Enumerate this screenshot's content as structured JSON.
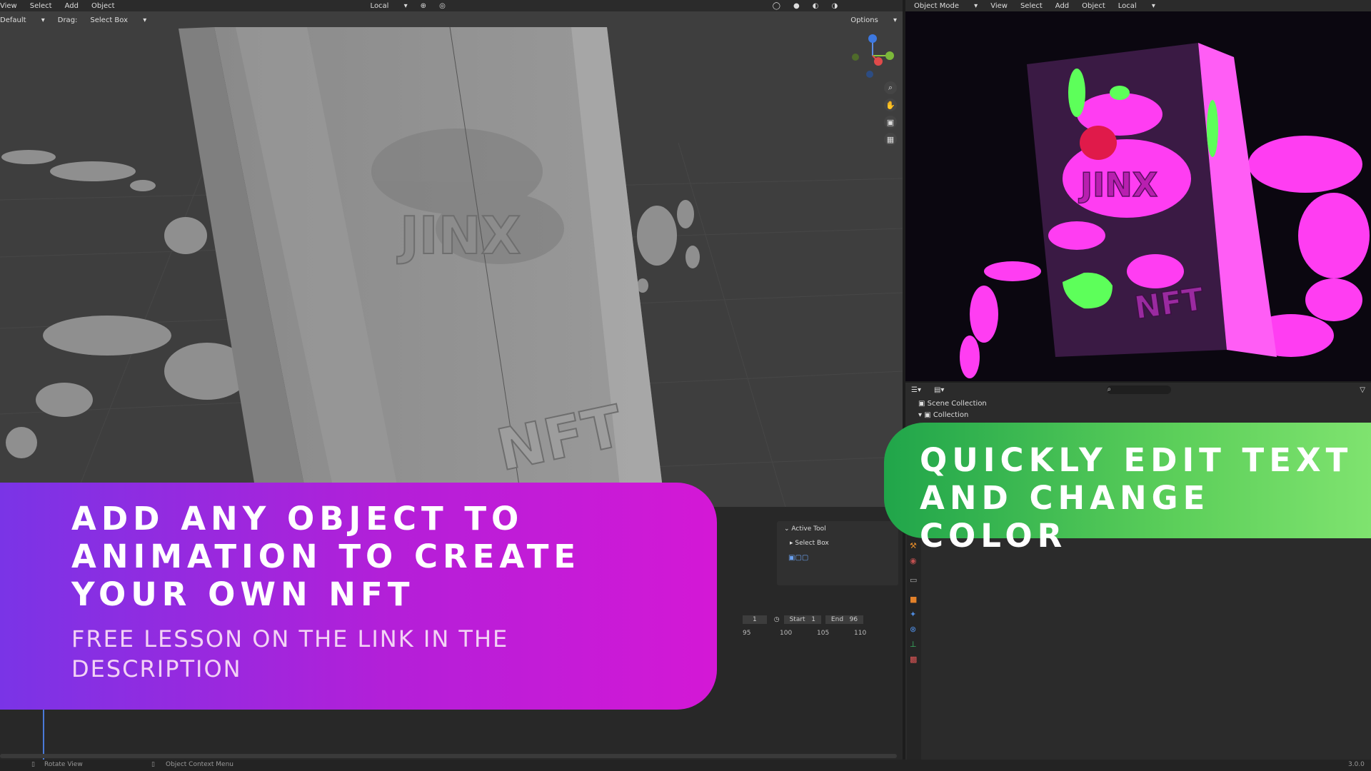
{
  "left_viewport": {
    "menu": [
      "View",
      "Select",
      "Add",
      "Object"
    ],
    "orientation": "Local",
    "mode_select": "Default",
    "drag_label": "Drag:",
    "drag_value": "Select Box",
    "options_label": "Options",
    "model_text_1": "JINX",
    "model_text_2": "NFT"
  },
  "right_viewport": {
    "mode": "Object Mode",
    "menu": [
      "View",
      "Select",
      "Add",
      "Object"
    ],
    "orientation": "Local",
    "model_text_1": "JINX",
    "model_text_2": "NFT"
  },
  "outliner": {
    "scene_collection": "Scene Collection",
    "collection": "Collection"
  },
  "active_tool": {
    "header": "Active Tool",
    "tool_name": "Select Box"
  },
  "timeline": {
    "current_frame": "1",
    "start_label": "Start",
    "start_value": "1",
    "end_label": "End",
    "end_value": "96",
    "ticks": [
      "95",
      "100",
      "105",
      "110"
    ]
  },
  "status_bar": {
    "left_action": "Rotate View",
    "middle_action": "Object Context Menu",
    "version": "3.0.0"
  },
  "overlay_left": {
    "title": "ADD ANY OBJECT TO ANIMATION TO CREATE YOUR OWN NFT",
    "subtitle": "FREE LESSON ON THE LINK IN THE DESCRIPTION"
  },
  "overlay_right": {
    "title": "QUICKLY EDIT TEXT AND CHANGE COLOR"
  },
  "colors": {
    "purple_start": "#7a34e6",
    "purple_end": "#d418d6",
    "green_start": "#20a54a",
    "green_end": "#7fe36f",
    "neon_pink": "#ff3df2",
    "neon_green": "#5dff5a"
  }
}
